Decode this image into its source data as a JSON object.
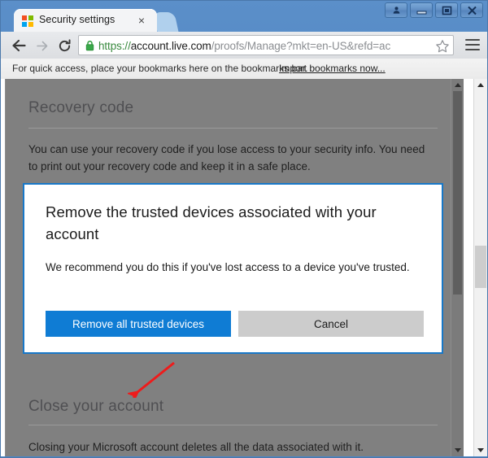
{
  "window": {
    "controls": [
      {
        "name": "user-account-button",
        "icon": "user-icon"
      },
      {
        "name": "minimize-button",
        "icon": "minimize-icon"
      },
      {
        "name": "maximize-button",
        "icon": "maximize-icon"
      },
      {
        "name": "close-button",
        "icon": "close-icon"
      }
    ]
  },
  "tab": {
    "title": "Security settings",
    "favicon": "microsoft-logo-icon",
    "close_label": "×",
    "favicon_colors": [
      "#f25022",
      "#7fba00",
      "#00a4ef",
      "#ffb900"
    ]
  },
  "toolbar": {
    "back_label": "←",
    "forward_label": "→",
    "reload_label": "⟳",
    "url_scheme": "https://",
    "url_host": "account.live.com",
    "url_path": "/proofs/Manage?mkt=en-US&refd=ac",
    "url_full": "https://account.live.com/proofs/Manage?mkt=en-US&refd=ac",
    "lock_icon": "secure-lock-icon",
    "bookmark_star": "star-icon",
    "menu_icon": "hamburger-menu-icon"
  },
  "bookmarks_bar": {
    "message": "For quick access, place your bookmarks here on the bookmarks bar.",
    "import_link": "Import bookmarks now..."
  },
  "page": {
    "recovery_section": {
      "title": "Recovery code",
      "body": "You can use your recovery code if you lose access to your security info. You need to print out your recovery code and keep it in a safe place."
    },
    "close_account_section": {
      "title": "Close your account",
      "body": "Closing your Microsoft account deletes all the data associated with it."
    }
  },
  "dialog": {
    "title": "Remove the trusted devices associated with your account",
    "body": "We recommend you do this if you've lost access to a device you've trusted.",
    "primary_button": "Remove all trusted devices",
    "secondary_button": "Cancel",
    "accent_color": "#0f7cd4",
    "border_color": "#1878c8",
    "secondary_color": "#cccccc"
  },
  "annotation": {
    "type": "arrow",
    "color": "#ee1b1b",
    "points_to": "Remove all trusted devices"
  },
  "scrollbars": {
    "page_scrollbar": "inner-page-scrollbar",
    "browser_scrollbar": "browser-scrollbar"
  }
}
